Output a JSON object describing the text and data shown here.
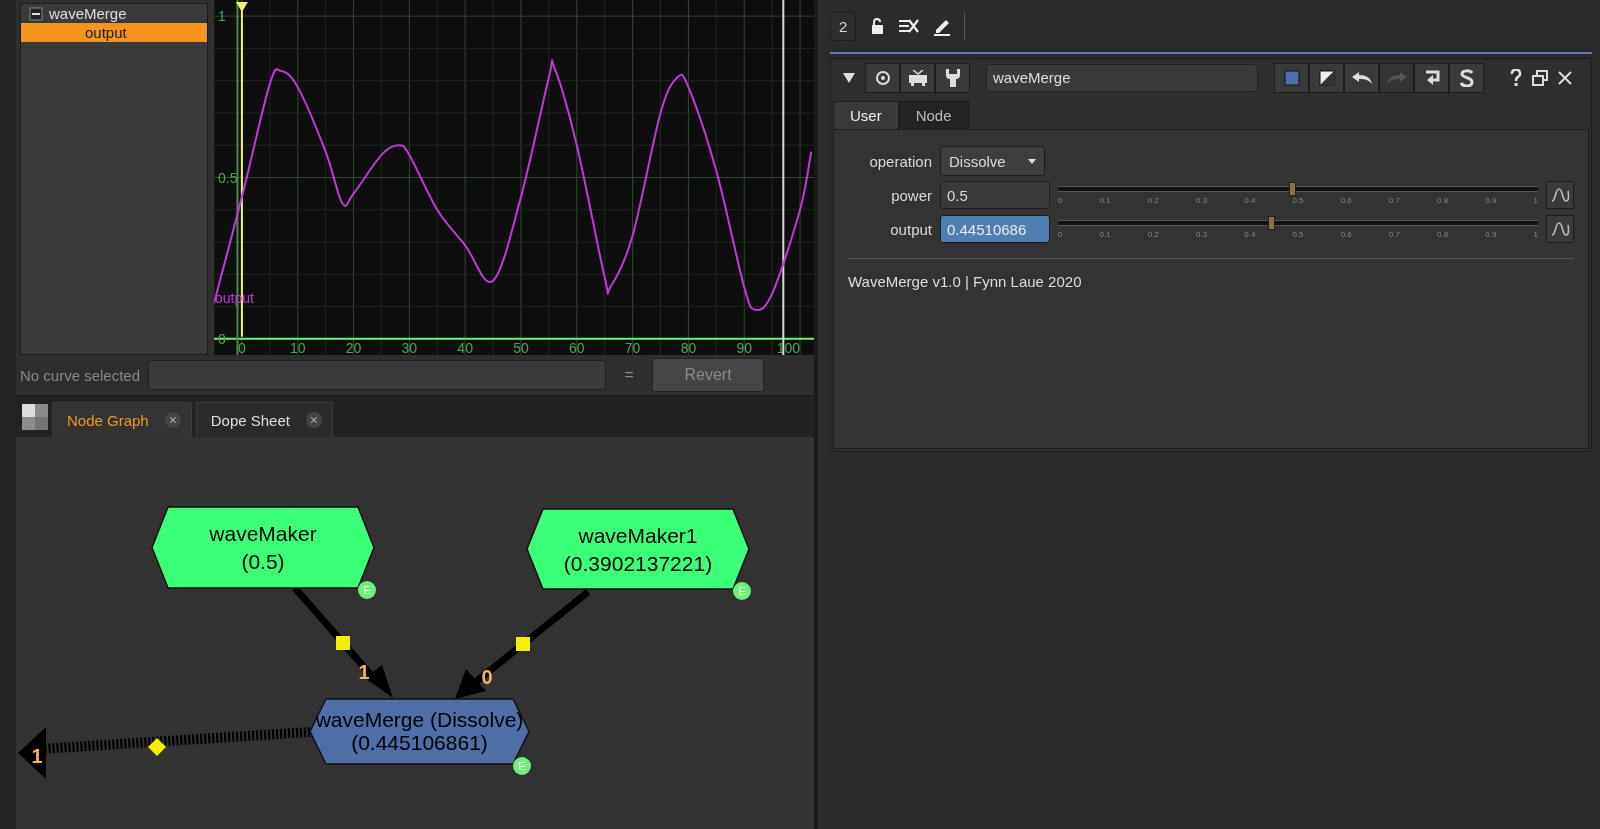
{
  "curve_editor": {
    "tree": [
      {
        "label": "waveMerge",
        "expanded": true,
        "children": [
          {
            "label": "output",
            "selected": true
          }
        ]
      }
    ],
    "chart_data": {
      "type": "line",
      "x": [
        -5,
        0,
        5,
        7,
        10,
        15,
        18,
        20,
        25,
        28,
        30,
        35,
        40,
        45,
        50,
        55,
        56,
        60,
        65,
        66,
        70,
        75,
        78,
        80,
        85,
        90,
        92,
        95,
        100,
        102
      ],
      "series": [
        {
          "name": "output",
          "color": "#c03ad8",
          "values": [
            0.11,
            0.44,
            0.79,
            0.83,
            0.78,
            0.58,
            0.42,
            0.45,
            0.57,
            0.6,
            0.57,
            0.4,
            0.29,
            0.18,
            0.44,
            0.81,
            0.84,
            0.6,
            0.19,
            0.16,
            0.32,
            0.7,
            0.81,
            0.78,
            0.52,
            0.16,
            0.09,
            0.14,
            0.4,
            0.58
          ]
        }
      ],
      "xlim": [
        -5,
        102.5
      ],
      "ylim": [
        -0.05,
        1.05
      ],
      "xticks": [
        0,
        10,
        20,
        30,
        40,
        50,
        60,
        70,
        80,
        90,
        100
      ],
      "yticks": [
        0,
        0.5,
        1
      ],
      "grid": true,
      "ref_lines": [
        {
          "axis": "x",
          "value": 0,
          "color": "#f0f07a"
        },
        {
          "axis": "x",
          "value": 97,
          "color": "#d8d8d8"
        }
      ]
    },
    "status": {
      "label": "No curve selected",
      "equals": "=",
      "revert_button": "Revert"
    }
  },
  "bottom_tabs": [
    {
      "label": "Node Graph",
      "selected": true,
      "close": "×"
    },
    {
      "label": "Dope Sheet",
      "selected": false,
      "close": "×"
    }
  ],
  "node_graph": {
    "nodes": [
      {
        "label": "waveMaker",
        "value": "(0.5)",
        "color": "#3cff78",
        "badge": "E"
      },
      {
        "label": "waveMaker1",
        "value": "(0.3902137221)",
        "color": "#3cff78",
        "badge": "E"
      },
      {
        "label": "waveMerge (Dissolve)",
        "value": "(0.445106861)",
        "color": "#4f6ea8",
        "badge": "E"
      }
    ],
    "edges": [
      {
        "kind": "input",
        "label": "1"
      },
      {
        "kind": "input",
        "label": "0"
      },
      {
        "kind": "output",
        "label": "1"
      }
    ]
  },
  "properties": {
    "count": "2",
    "node_name": "waveMerge",
    "tabs": [
      {
        "label": "User",
        "selected": true
      },
      {
        "label": "Node",
        "selected": false
      }
    ],
    "knobs": [
      {
        "kind": "dropdown",
        "label": "operation",
        "value": "Dissolve"
      },
      {
        "kind": "slider",
        "label": "power",
        "value": "0.5",
        "level": 0.49,
        "highlighted": false,
        "ticks": [
          "0",
          "0.1",
          "0.2",
          "0.3",
          "0.4",
          "0.5",
          "0.6",
          "0.7",
          "0.8",
          "0.9",
          "1"
        ]
      },
      {
        "kind": "slider",
        "label": "output",
        "value": "0.44510686",
        "level": 0.445,
        "highlighted": true,
        "ticks": [
          "0",
          "0.1",
          "0.2",
          "0.3",
          "0.4",
          "0.5",
          "0.6",
          "0.7",
          "0.8",
          "0.9",
          "1"
        ]
      }
    ],
    "footer": "WaveMerge v1.0 | Fynn Laue 2020"
  }
}
